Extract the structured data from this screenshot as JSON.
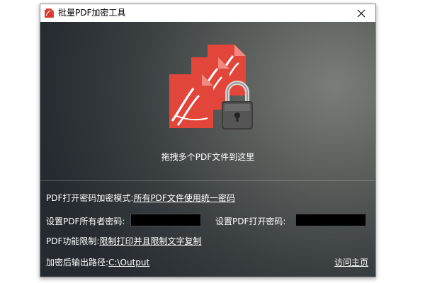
{
  "window": {
    "title": "批量PDF加密工具",
    "close_symbol": "✕"
  },
  "dropzone": {
    "hint": "拖拽多个PDF文件到这里"
  },
  "settings": {
    "mode_label": "PDF打开密码加密模式:",
    "mode_value": "所有PDF文件使用统一密码",
    "owner_pwd_label": "设置PDF所有者密码:",
    "owner_pwd_value": "",
    "open_pwd_label": "设置PDF打开密码:",
    "open_pwd_value": "",
    "restrict_label": "PDF功能限制:",
    "restrict_value": "限制打印并且限制文字复制",
    "output_label": "加密后输出路径:",
    "output_value": "C:\\Output",
    "homepage_link": "访问主页"
  },
  "icons": {
    "app": "pdf-app-icon",
    "close": "close-icon",
    "pdf": "pdf-file-icon",
    "lock": "padlock-icon"
  },
  "colors": {
    "pdf_red": "#e2463a",
    "text": "#ffffff"
  }
}
